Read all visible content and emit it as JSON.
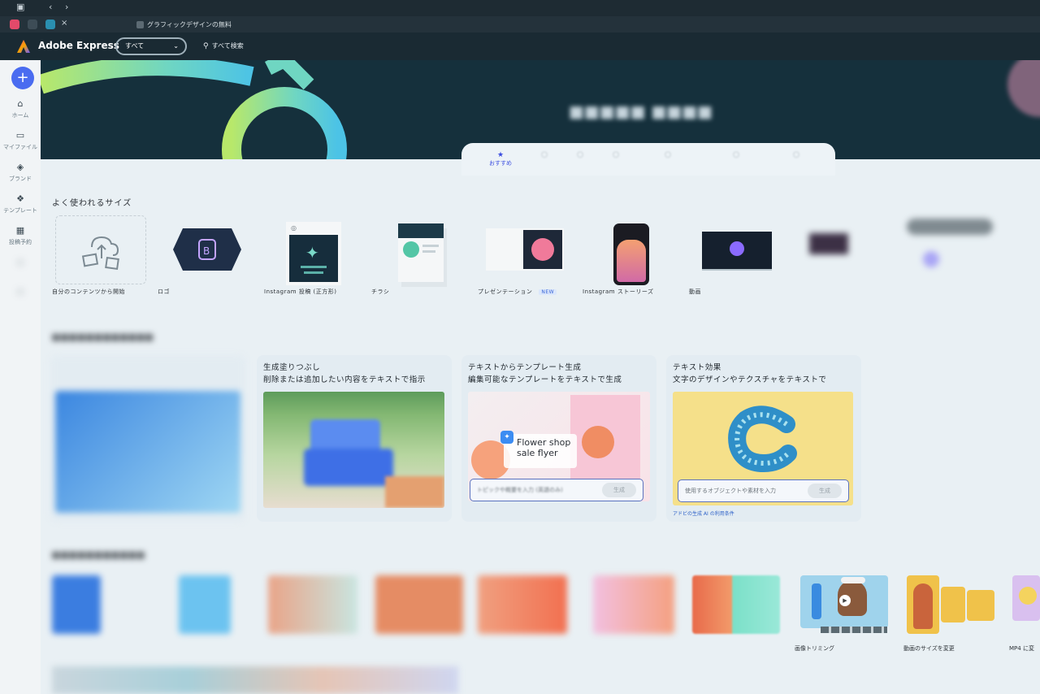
{
  "browser": {
    "active_tab_title": "グラフィックデザインの無料",
    "close_tab": "×",
    "back": "‹",
    "forward": "›"
  },
  "app": {
    "name": "Adobe Express",
    "scope_value": "すべて",
    "search_placeholder": "すべて検索",
    "create_label": "+"
  },
  "sidebar": {
    "items": [
      {
        "icon": "home-icon",
        "label": "ホーム"
      },
      {
        "icon": "folder-icon",
        "label": "マイファイル"
      },
      {
        "icon": "brand-icon",
        "label": "ブランド"
      },
      {
        "icon": "template-icon",
        "label": "テンプレート"
      },
      {
        "icon": "calendar-icon",
        "label": "投稿予約"
      }
    ]
  },
  "tabs": {
    "active_label": "おすすめ"
  },
  "common_sizes": {
    "heading": "よく使われるサイズ",
    "items": [
      {
        "label": "自分のコンテンツから開始"
      },
      {
        "label": "ロゴ"
      },
      {
        "label": "Instagram 投稿 (正方形)"
      },
      {
        "label": "チラシ"
      },
      {
        "label": "プレゼンテーション",
        "badge": "NEW"
      },
      {
        "label": "Instagram ストーリーズ"
      },
      {
        "label": "動画"
      }
    ]
  },
  "ai_cards": [
    {
      "title": "生成塗りつぶし",
      "subtitle": "削除または追加したい内容をテキストで指示"
    },
    {
      "title": "テキストからテンプレート生成",
      "subtitle": "編集可能なテンプレートをテキストで生成",
      "overlay": "Flower shop sale flyer",
      "prompt_placeholder": "トピックや概要を入力 (英語のみ)",
      "generate": "生成"
    },
    {
      "title": "テキスト効果",
      "subtitle": "文字のデザインやテクスチャをテキストで",
      "prompt_placeholder": "使用するオブジェクトや素材を入力",
      "generate": "生成",
      "terms": "アドビの生成 AI の利用条件"
    }
  ],
  "quick_actions": [
    {
      "label": "画像トリミング"
    },
    {
      "label": "動画のサイズを変更"
    },
    {
      "label": "MP4 に変"
    }
  ],
  "colors": {
    "accent": "#4a6cf0",
    "hero_bg": "#15303c",
    "page_bg": "#e9f0f4"
  }
}
